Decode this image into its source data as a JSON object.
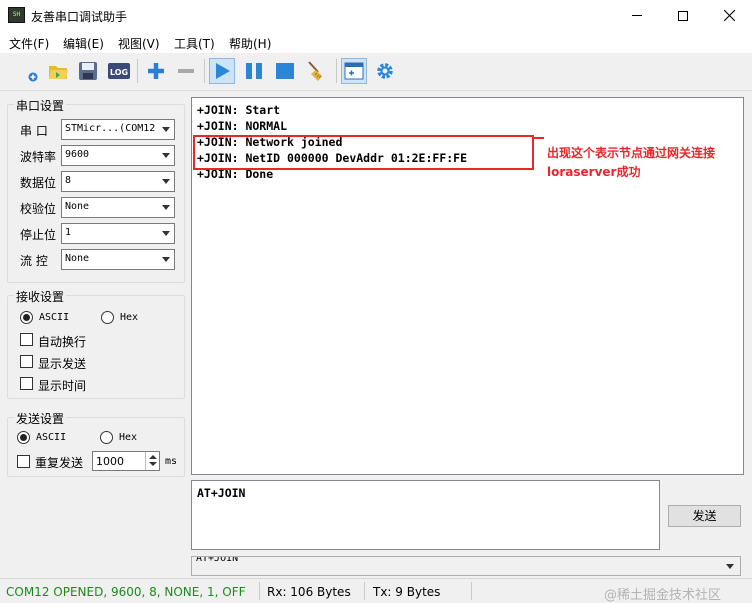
{
  "window": {
    "title": "友善串口调试助手",
    "icon_text": "SH"
  },
  "menu": [
    "文件(F)",
    "编辑(E)",
    "视图(V)",
    "工具(T)",
    "帮助(H)"
  ],
  "toolbar": {
    "icons": [
      "new-icon",
      "open-folder-icon",
      "save-icon",
      "log-icon",
      "add-icon",
      "remove-icon",
      "play-icon",
      "pause-icon",
      "stop-icon",
      "broom-icon",
      "window-icon",
      "gear-icon"
    ],
    "log_label": "LOG",
    "colors": {
      "accent": "#2a7ed6",
      "play": "#2b86d8"
    }
  },
  "serial": {
    "title": "串口设置",
    "fields": [
      {
        "label": "串 口",
        "value": "STMicr...(COM12"
      },
      {
        "label": "波特率",
        "value": "9600"
      },
      {
        "label": "数据位",
        "value": "8"
      },
      {
        "label": "校验位",
        "value": "None"
      },
      {
        "label": "停止位",
        "value": "1"
      },
      {
        "label": "流 控",
        "value": "None"
      }
    ]
  },
  "receive": {
    "title": "接收设置",
    "ascii": "ASCII",
    "hex": "Hex",
    "options": [
      "自动换行",
      "显示发送",
      "显示时间"
    ]
  },
  "send": {
    "title": "发送设置",
    "ascii": "ASCII",
    "hex": "Hex",
    "repeat_label": "重复发送",
    "interval": "1000",
    "unit": "ms"
  },
  "receive_log": [
    "+JOIN: Start",
    "+JOIN: NORMAL",
    "+JOIN: Network joined",
    "+JOIN: NetID 000000 DevAddr 01:2E:FF:FE",
    "+JOIN: Done"
  ],
  "annotation": {
    "line1": "出现这个表示节点通过网关连接",
    "line2": "loraserver成功",
    "color": "#e8272b"
  },
  "send_area": {
    "text": "AT+JOIN",
    "button": "发送"
  },
  "history": {
    "value": "AT+JOIN"
  },
  "status": {
    "connection": "COM12 OPENED, 9600, 8, NONE, 1, OFF",
    "rx": "Rx: 106 Bytes",
    "tx": "Tx: 9 Bytes",
    "connection_color": "#1a8a1a"
  },
  "watermark": "@稀土掘金技术社区"
}
